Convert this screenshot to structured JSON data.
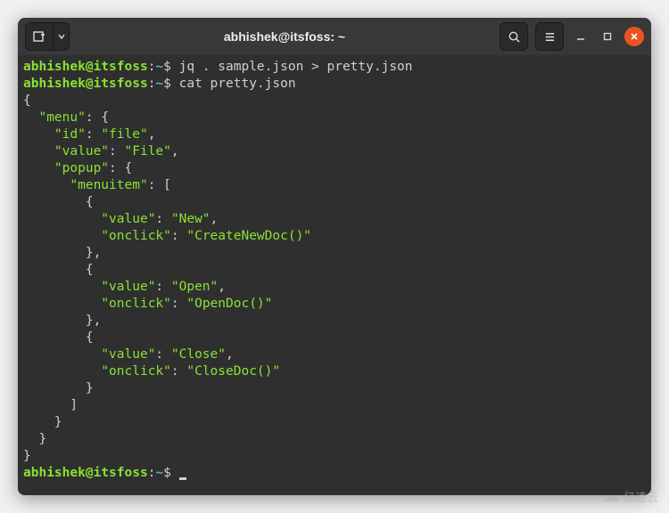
{
  "titlebar": {
    "title": "abhishek@itsfoss: ~"
  },
  "prompt": {
    "user_host": "abhishek@itsfoss",
    "separator": ":",
    "path": "~",
    "symbol": "$"
  },
  "commands": {
    "cmd1": "jq . sample.json > pretty.json",
    "cmd2": "cat pretty.json"
  },
  "output_lines": [
    "{",
    "  \"menu\": {",
    "    \"id\": \"file\",",
    "    \"value\": \"File\",",
    "    \"popup\": {",
    "      \"menuitem\": [",
    "        {",
    "          \"value\": \"New\",",
    "          \"onclick\": \"CreateNewDoc()\"",
    "        },",
    "        {",
    "          \"value\": \"Open\",",
    "          \"onclick\": \"OpenDoc()\"",
    "        },",
    "        {",
    "          \"value\": \"Close\",",
    "          \"onclick\": \"CloseDoc()\"",
    "        }",
    "      ]",
    "    }",
    "  }",
    "}"
  ],
  "watermark": {
    "text": "亿速云"
  }
}
